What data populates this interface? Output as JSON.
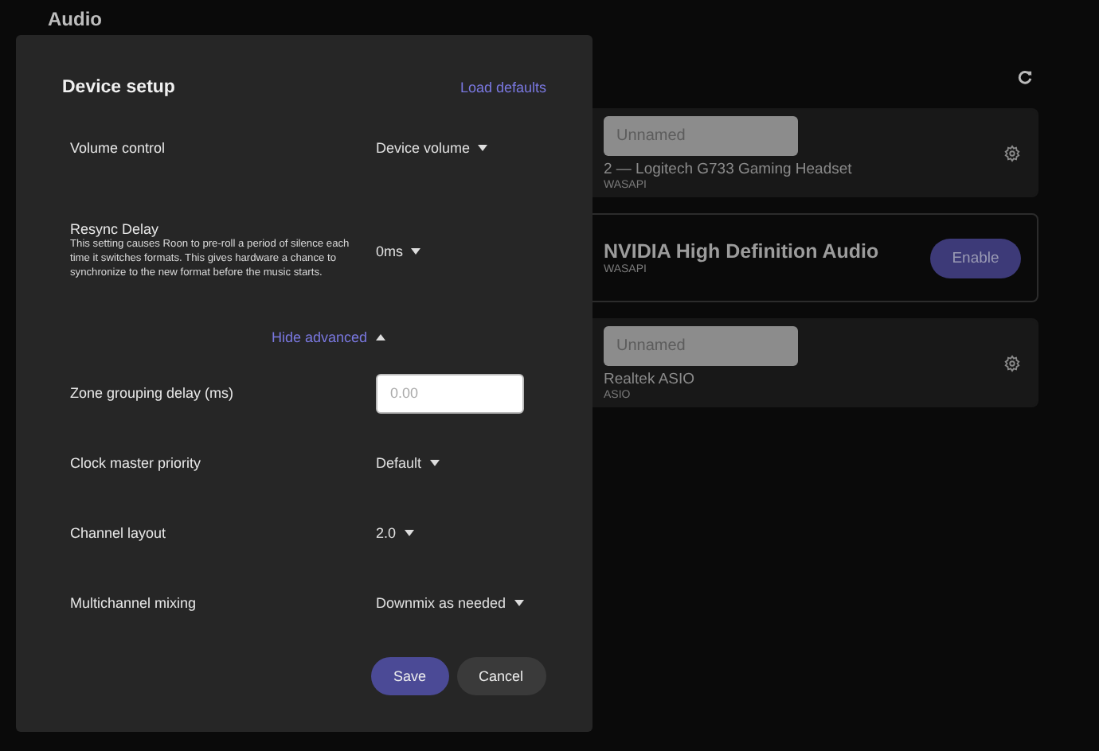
{
  "page": {
    "title": "Audio"
  },
  "devices": [
    {
      "kind": "enabled",
      "name_placeholder": "Unnamed",
      "device": "2 — Logitech G733 Gaming Headset",
      "driver": "WASAPI"
    },
    {
      "kind": "disabled",
      "device": "NVIDIA High Definition Audio",
      "driver": "WASAPI",
      "action": "Enable"
    },
    {
      "kind": "enabled",
      "name_placeholder": "Unnamed",
      "device": "Realtek ASIO",
      "driver": "ASIO"
    }
  ],
  "dialog": {
    "title": "Device setup",
    "load_defaults": "Load defaults",
    "settings": [
      {
        "kind": "dropdown",
        "label": "Volume control",
        "value": "Device volume"
      },
      {
        "kind": "dropdown",
        "label": "Resync Delay",
        "description": "This setting causes Roon to pre-roll a period of silence each time it switches formats. This gives hardware a chance to synchronize to the new format before the music starts.",
        "value": "0ms"
      }
    ],
    "advanced_toggle": {
      "label": "Hide advanced",
      "expanded": true
    },
    "advanced": [
      {
        "kind": "input",
        "label": "Zone grouping delay (ms)",
        "placeholder": "0.00"
      },
      {
        "kind": "dropdown",
        "label": "Clock master priority",
        "value": "Default"
      },
      {
        "kind": "dropdown",
        "label": "Channel layout",
        "value": "2.0"
      },
      {
        "kind": "dropdown",
        "label": "Multichannel mixing",
        "value": "Downmix as needed"
      }
    ],
    "buttons": [
      "Save",
      "Cancel"
    ]
  }
}
